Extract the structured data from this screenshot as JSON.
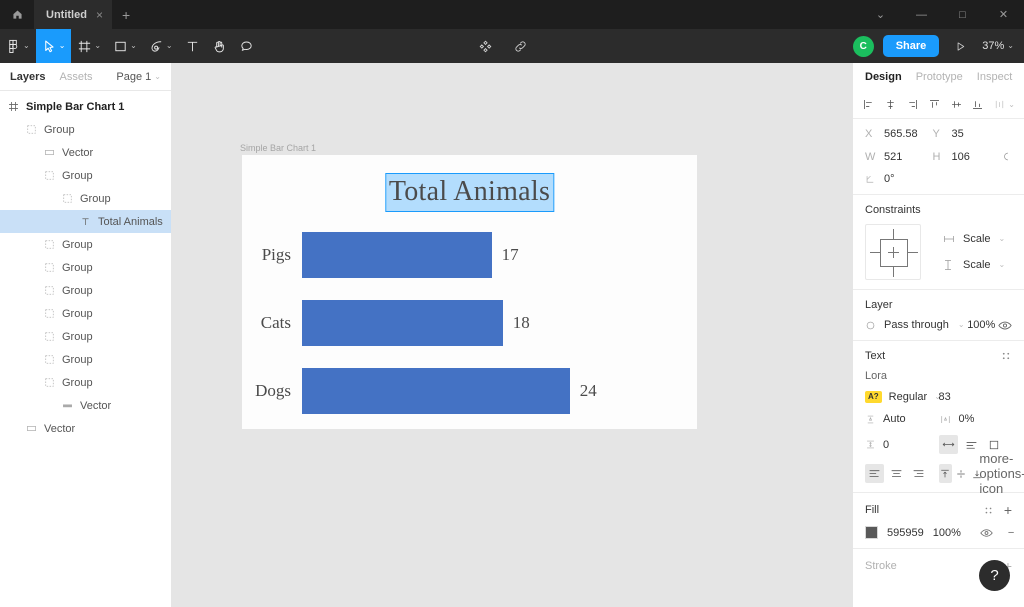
{
  "titlebar": {
    "home_icon": "home-icon",
    "tab_name": "Untitled",
    "tab_close": "×",
    "new_tab": "+",
    "window_chevron": "⌄",
    "window_minimize": "—",
    "window_maximize": "□",
    "window_close": "✕"
  },
  "toolbar": {
    "tools": [
      {
        "name": "figma-menu-icon",
        "caret": "⌄",
        "active": false
      },
      {
        "name": "move-tool-icon",
        "caret": "⌄",
        "active": true
      },
      {
        "name": "frame-tool-icon",
        "caret": "⌄",
        "active": false
      },
      {
        "name": "shape-tool-icon",
        "caret": "⌄",
        "active": false
      },
      {
        "name": "pen-tool-icon",
        "caret": "⌄",
        "active": false
      },
      {
        "name": "text-tool-icon",
        "caret": "",
        "active": false
      },
      {
        "name": "hand-tool-icon",
        "caret": "",
        "active": false
      },
      {
        "name": "comment-tool-icon",
        "caret": "",
        "active": false
      }
    ],
    "components_icon": "components-icon",
    "link_icon": "link-icon",
    "avatar_initial": "C",
    "avatar_color": "#1bbe5e",
    "share_label": "Share",
    "share_color": "#1a9bfc",
    "present_icon": "play-icon",
    "zoom_level": "37%",
    "zoom_caret": "⌄"
  },
  "left_panel": {
    "tab_layers": "Layers",
    "tab_assets": "Assets",
    "page_name": "Page 1",
    "page_caret": "⌄",
    "layers": [
      {
        "label": "Simple Bar Chart 1",
        "indent": 0,
        "icon": "frame-icon",
        "selected": false,
        "root": true
      },
      {
        "label": "Group",
        "indent": 1,
        "icon": "group-icon",
        "selected": false,
        "root": false
      },
      {
        "label": "Vector",
        "indent": 2,
        "icon": "vector-icon",
        "selected": false,
        "root": false
      },
      {
        "label": "Group",
        "indent": 2,
        "icon": "group-icon",
        "selected": false,
        "root": false
      },
      {
        "label": "Group",
        "indent": 3,
        "icon": "group-icon",
        "selected": false,
        "root": false
      },
      {
        "label": "Total Animals",
        "indent": 4,
        "icon": "text-icon",
        "selected": true,
        "root": false
      },
      {
        "label": "Group",
        "indent": 2,
        "icon": "group-icon",
        "selected": false,
        "root": false
      },
      {
        "label": "Group",
        "indent": 2,
        "icon": "group-icon",
        "selected": false,
        "root": false
      },
      {
        "label": "Group",
        "indent": 2,
        "icon": "group-icon",
        "selected": false,
        "root": false
      },
      {
        "label": "Group",
        "indent": 2,
        "icon": "group-icon",
        "selected": false,
        "root": false
      },
      {
        "label": "Group",
        "indent": 2,
        "icon": "group-icon",
        "selected": false,
        "root": false
      },
      {
        "label": "Group",
        "indent": 2,
        "icon": "group-icon",
        "selected": false,
        "root": false
      },
      {
        "label": "Group",
        "indent": 2,
        "icon": "group-icon",
        "selected": false,
        "root": false
      },
      {
        "label": "Vector",
        "indent": 3,
        "icon": "vector-line-icon",
        "selected": false,
        "root": false
      },
      {
        "label": "Vector",
        "indent": 1,
        "icon": "vector-icon",
        "selected": false,
        "root": false
      }
    ]
  },
  "canvas": {
    "frame_label": "Simple Bar Chart 1",
    "selection_color": "#1a9bfc"
  },
  "chart_data": {
    "type": "bar",
    "orientation": "horizontal",
    "title": "Total Animals",
    "categories": [
      "Pigs",
      "Cats",
      "Dogs"
    ],
    "values": [
      17,
      18,
      24
    ],
    "value_labels": [
      "17",
      "18",
      "24"
    ],
    "bar_color": "#4472c4",
    "xlabel": "",
    "ylabel": "",
    "xlim": [
      0,
      26
    ],
    "grid": false,
    "legend": false
  },
  "right_panel": {
    "tabs": [
      {
        "label": "Design",
        "active": true
      },
      {
        "label": "Prototype",
        "active": false
      },
      {
        "label": "Inspect",
        "active": false
      }
    ],
    "align_icons": [
      "align-left-icon",
      "align-horizontal-center-icon",
      "align-right-icon",
      "align-top-icon",
      "align-vertical-center-icon",
      "align-bottom-icon",
      "distribute-icon"
    ],
    "align_caret": "⌄",
    "transform": {
      "x_label": "X",
      "x_value": "565.58",
      "y_label": "Y",
      "y_value": "35",
      "w_label": "W",
      "w_value": "521",
      "h_label": "H",
      "h_value": "106",
      "rotation_label": "rotation-icon",
      "rotation_value": "0°",
      "constrain_icon": "constrain-proportions-icon"
    },
    "constraints": {
      "title": "Constraints",
      "horizontal_icon": "horizontal-constraint-icon",
      "horizontal_value": "Scale",
      "vertical_icon": "vertical-constraint-icon",
      "vertical_value": "Scale",
      "caret": "⌄"
    },
    "layer": {
      "title": "Layer",
      "blend_icon": "blend-mode-icon",
      "blend_mode": "Pass through",
      "caret": "⌄",
      "opacity": "100%",
      "visibility_icon": "eye-icon"
    },
    "text": {
      "title": "Text",
      "type_detail_icon": "type-details-icon",
      "font_family": "Lora",
      "font_style_badge": "A?",
      "font_style": "Regular",
      "style_caret": "⌄",
      "font_size": "83",
      "line_height_icon": "line-height-icon",
      "line_height": "Auto",
      "letter_spacing_icon": "letter-spacing-icon",
      "letter_spacing": "0%",
      "paragraph_spacing_icon": "paragraph-spacing-icon",
      "paragraph_spacing": "0",
      "resize_auto_width_icon": "auto-width-icon",
      "resize_auto_height_icon": "auto-height-icon",
      "resize_fixed_icon": "fixed-size-icon",
      "align_left_icon": "text-align-left-icon",
      "align_center_icon": "text-align-center-icon",
      "align_right_icon": "text-align-right-icon",
      "valign_top_icon": "text-valign-top-icon",
      "valign_middle_icon": "text-valign-middle-icon",
      "valign_bottom_icon": "text-valign-bottom-icon",
      "more_icon": "more-options-icon"
    },
    "fill": {
      "title": "Fill",
      "styles_icon": "fill-styles-icon",
      "add_icon": "+",
      "color_hex": "595959",
      "color_value": "#595959",
      "opacity": "100%",
      "visibility_icon": "eye-icon",
      "remove_icon": "−"
    },
    "stroke": {
      "title": "Stroke",
      "add_icon": "+"
    },
    "help_label": "?"
  }
}
